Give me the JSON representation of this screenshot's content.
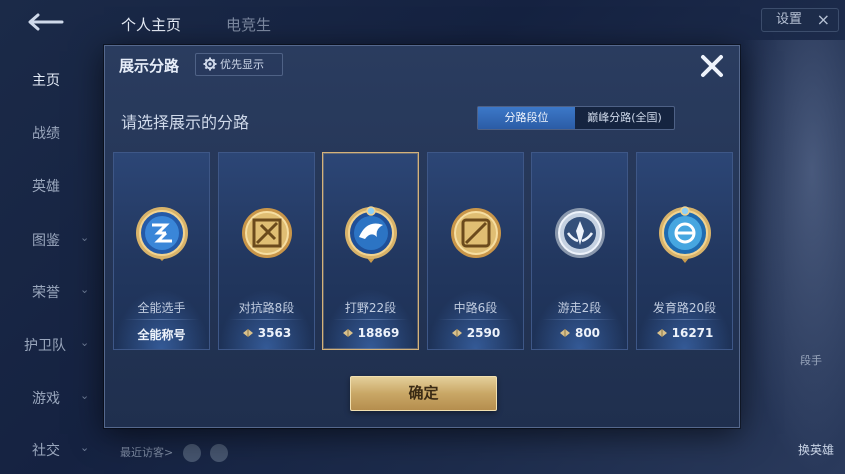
{
  "background": {
    "tabs": [
      "个人主页",
      "电竞生"
    ],
    "settings_label": "设置",
    "sidebar": [
      {
        "label": "主页",
        "active": true,
        "chevron": false
      },
      {
        "label": "战绩",
        "active": false,
        "chevron": false
      },
      {
        "label": "英雄",
        "active": false,
        "chevron": false
      },
      {
        "label": "图鉴",
        "active": false,
        "chevron": true
      },
      {
        "label": "荣誉",
        "active": false,
        "chevron": true
      },
      {
        "label": "护卫队",
        "active": false,
        "chevron": true
      },
      {
        "label": "游戏",
        "active": false,
        "chevron": true
      },
      {
        "label": "社交",
        "active": false,
        "chevron": true
      }
    ],
    "recent_visitors_label": "最近访客>",
    "rank_label": "段手",
    "change_hero_label": "换英雄"
  },
  "modal": {
    "title": "展示分路",
    "priority_button": "优先显示",
    "subtitle": "请选择展示的分路",
    "segments": [
      {
        "label": "分路段位",
        "active": true
      },
      {
        "label": "巅峰分路(全国)",
        "active": false
      }
    ],
    "cards": [
      {
        "name": "全能选手",
        "score": "全能称号",
        "has_points_icon": false,
        "selected": false,
        "emblem": "all-round-emblem-icon"
      },
      {
        "name": "对抗路8段",
        "score": "3563",
        "has_points_icon": true,
        "selected": false,
        "emblem": "clash-lane-emblem-icon"
      },
      {
        "name": "打野22段",
        "score": "18869",
        "has_points_icon": true,
        "selected": true,
        "emblem": "jungle-emblem-icon"
      },
      {
        "name": "中路6段",
        "score": "2590",
        "has_points_icon": true,
        "selected": false,
        "emblem": "mid-lane-emblem-icon"
      },
      {
        "name": "游走2段",
        "score": "800",
        "has_points_icon": true,
        "selected": false,
        "emblem": "roam-emblem-icon"
      },
      {
        "name": "发育路20段",
        "score": "16271",
        "has_points_icon": true,
        "selected": false,
        "emblem": "farm-lane-emblem-icon"
      }
    ],
    "confirm_label": "确定"
  },
  "colors": {
    "gold": "#d4b27a",
    "accent_blue": "#3c78c8",
    "modal_bg": "#24365a"
  }
}
